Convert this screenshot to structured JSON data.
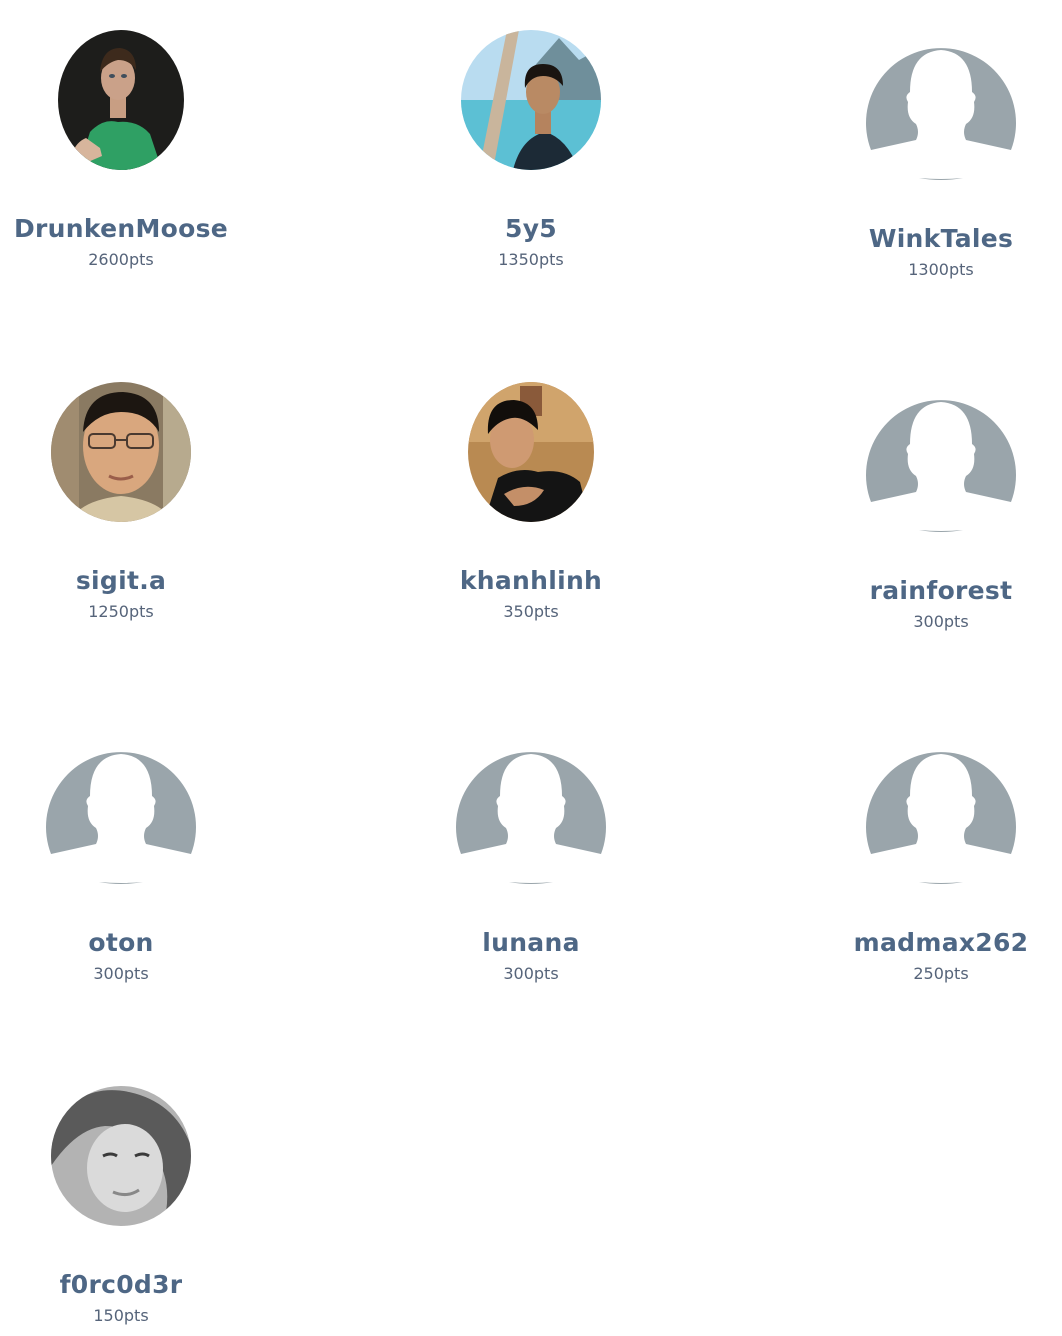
{
  "leaderboard": {
    "users": [
      {
        "name": "DrunkenMoose",
        "points": "2600pts",
        "avatar": "photo"
      },
      {
        "name": "5y5",
        "points": "1350pts",
        "avatar": "photo"
      },
      {
        "name": "WinkTales",
        "points": "1300pts",
        "avatar": "default-silhouette"
      },
      {
        "name": "sigit.a",
        "points": "1250pts",
        "avatar": "photo"
      },
      {
        "name": "khanhlinh",
        "points": "350pts",
        "avatar": "photo"
      },
      {
        "name": "rainforest",
        "points": "300pts",
        "avatar": "default-silhouette"
      },
      {
        "name": "oton",
        "points": "300pts",
        "avatar": "default-silhouette"
      },
      {
        "name": "lunana",
        "points": "300pts",
        "avatar": "default-silhouette"
      },
      {
        "name": "madmax262",
        "points": "250pts",
        "avatar": "default-silhouette"
      },
      {
        "name": "f0rc0d3r",
        "points": "150pts",
        "avatar": "photo"
      }
    ]
  },
  "colors": {
    "name_text": "#4e6785",
    "points_text": "#56647a",
    "silhouette_gray": "#9aa5ab"
  }
}
